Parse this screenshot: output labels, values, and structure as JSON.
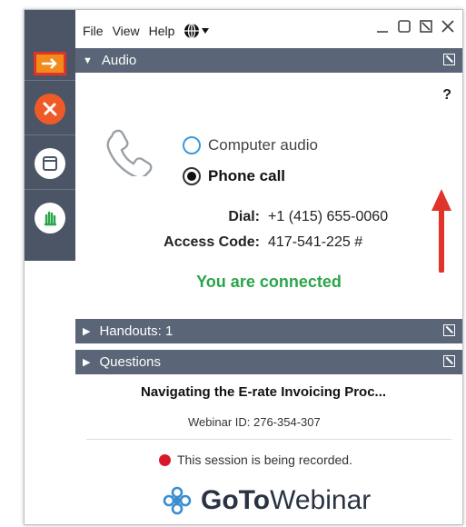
{
  "menu": {
    "file": "File",
    "view": "View",
    "help": "Help"
  },
  "sections": {
    "audio": "Audio",
    "handouts": "Handouts: 1",
    "questions": "Questions"
  },
  "audio": {
    "help_mark": "?",
    "option_computer": "Computer audio",
    "option_phone": "Phone call",
    "selected": "Phone call",
    "dial_label": "Dial:",
    "dial_value": "+1 (415) 655-0060",
    "access_label": "Access Code:",
    "access_value": "417-541-225 #",
    "status": "You are connected"
  },
  "session": {
    "title": "Navigating the E-rate Invoicing Proc...",
    "webinar_id": "Webinar ID: 276-354-307",
    "recording_notice": "This session is being recorded."
  },
  "logo": {
    "part1": "GoTo",
    "part2": "Webinar"
  },
  "colors": {
    "toolbar": "#4b5566",
    "section_header": "#5a6577",
    "connected_green": "#2aa54a",
    "accent_orange": "#f28a1c",
    "highlight_red": "#e0342a",
    "record_red": "#d9182a"
  },
  "icons": {
    "toolbar": [
      "arrow-right-icon",
      "hangup-icon",
      "screen-icon",
      "raise-hand-icon"
    ],
    "menu": "globe-icon",
    "audio": "phone-icon"
  }
}
